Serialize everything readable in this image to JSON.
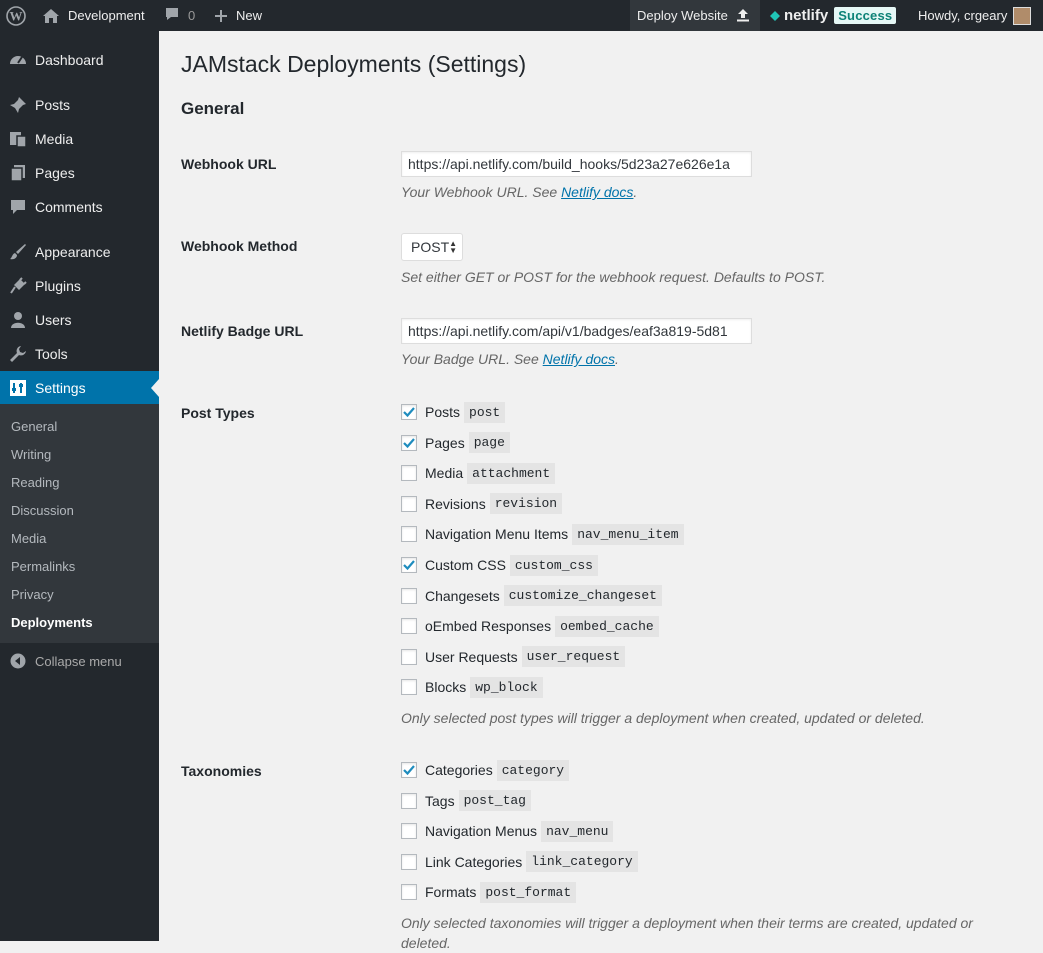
{
  "adminbar": {
    "site_name": "Development",
    "comment_count": "0",
    "new_label": "New",
    "deploy_label": "Deploy Website",
    "netlify_label": "netlify",
    "status_badge": "Success",
    "howdy": "Howdy, crgeary"
  },
  "sidebar": {
    "items": [
      {
        "label": "Dashboard",
        "icon": "dashboard-icon"
      },
      {
        "label": "Posts",
        "icon": "pin-icon"
      },
      {
        "label": "Media",
        "icon": "media-icon"
      },
      {
        "label": "Pages",
        "icon": "pages-icon"
      },
      {
        "label": "Comments",
        "icon": "comment-icon"
      },
      {
        "label": "Appearance",
        "icon": "brush-icon"
      },
      {
        "label": "Plugins",
        "icon": "plugin-icon"
      },
      {
        "label": "Users",
        "icon": "user-icon"
      },
      {
        "label": "Tools",
        "icon": "wrench-icon"
      },
      {
        "label": "Settings",
        "icon": "settings-icon"
      }
    ],
    "submenu": [
      "General",
      "Writing",
      "Reading",
      "Discussion",
      "Media",
      "Permalinks",
      "Privacy",
      "Deployments"
    ],
    "collapse_label": "Collapse menu"
  },
  "page": {
    "title": "JAMstack Deployments (Settings)",
    "section": "General"
  },
  "webhook_url": {
    "label": "Webhook URL",
    "value": "https://api.netlify.com/build_hooks/5d23a27e626e1a",
    "desc_prefix": "Your Webhook URL. See ",
    "link": "Netlify docs",
    "desc_suffix": "."
  },
  "webhook_method": {
    "label": "Webhook Method",
    "value": "POST",
    "desc": "Set either GET or POST for the webhook request. Defaults to POST."
  },
  "badge_url": {
    "label": "Netlify Badge URL",
    "value": "https://api.netlify.com/api/v1/badges/eaf3a819-5d81",
    "desc_prefix": "Your Badge URL. See ",
    "link": "Netlify docs",
    "desc_suffix": "."
  },
  "post_types": {
    "label": "Post Types",
    "items": [
      {
        "label": "Posts",
        "code": "post",
        "checked": true
      },
      {
        "label": "Pages",
        "code": "page",
        "checked": true
      },
      {
        "label": "Media",
        "code": "attachment",
        "checked": false
      },
      {
        "label": "Revisions",
        "code": "revision",
        "checked": false
      },
      {
        "label": "Navigation Menu Items",
        "code": "nav_menu_item",
        "checked": false
      },
      {
        "label": "Custom CSS",
        "code": "custom_css",
        "checked": true
      },
      {
        "label": "Changesets",
        "code": "customize_changeset",
        "checked": false
      },
      {
        "label": "oEmbed Responses",
        "code": "oembed_cache",
        "checked": false
      },
      {
        "label": "User Requests",
        "code": "user_request",
        "checked": false
      },
      {
        "label": "Blocks",
        "code": "wp_block",
        "checked": false
      }
    ],
    "desc": "Only selected post types will trigger a deployment when created, updated or deleted."
  },
  "taxonomies": {
    "label": "Taxonomies",
    "items": [
      {
        "label": "Categories",
        "code": "category",
        "checked": true
      },
      {
        "label": "Tags",
        "code": "post_tag",
        "checked": false
      },
      {
        "label": "Navigation Menus",
        "code": "nav_menu",
        "checked": false
      },
      {
        "label": "Link Categories",
        "code": "link_category",
        "checked": false
      },
      {
        "label": "Formats",
        "code": "post_format",
        "checked": false
      }
    ],
    "desc": "Only selected taxonomies will trigger a deployment when their terms are created, updated or deleted."
  },
  "colors": {
    "accent": "#0073aa",
    "sidebar_bg": "#23282d",
    "netlify_teal": "#0d8277"
  }
}
